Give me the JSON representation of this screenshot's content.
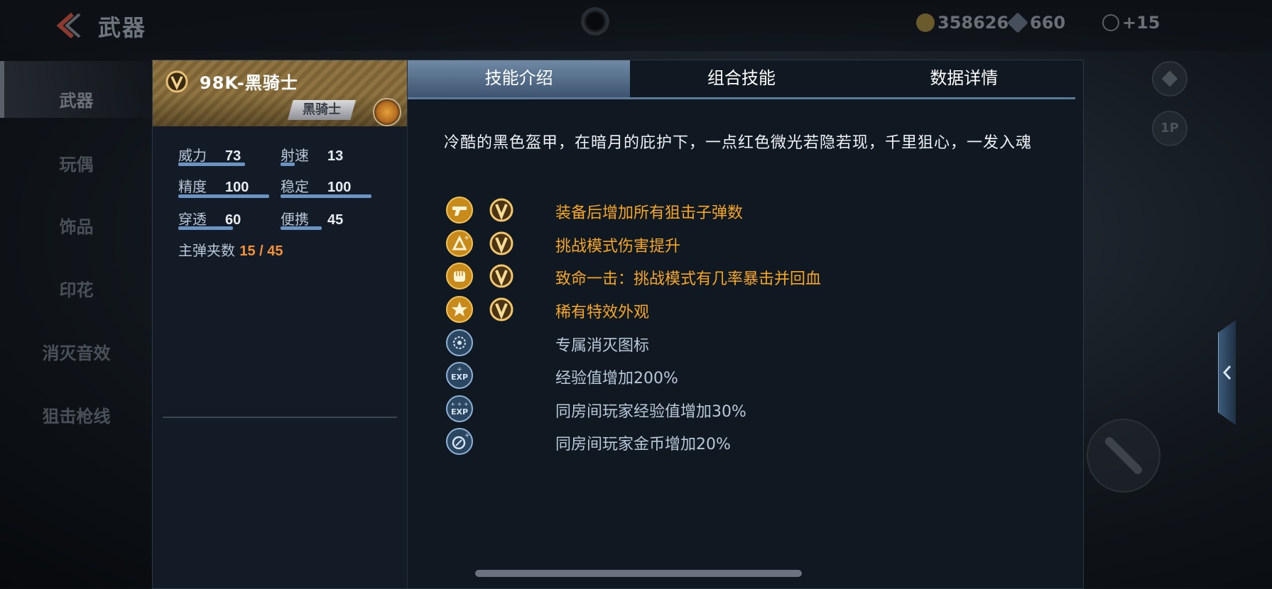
{
  "header": {
    "title": "武器",
    "gold": "358626",
    "diamond": "660",
    "energy": "+15"
  },
  "sidebar": {
    "items": [
      {
        "label": "武器"
      },
      {
        "label": "玩偶"
      },
      {
        "label": "饰品"
      },
      {
        "label": "印花"
      },
      {
        "label": "消灭音效"
      },
      {
        "label": "狙击枪线"
      }
    ]
  },
  "right_buttons": {
    "view_label": "1P"
  },
  "weapon": {
    "name": "98K-黑骑士",
    "tag": "黑骑士",
    "stats": [
      {
        "label": "威力",
        "value": "73"
      },
      {
        "label": "射速",
        "value": "13"
      },
      {
        "label": "精度",
        "value": "100"
      },
      {
        "label": "稳定",
        "value": "100"
      },
      {
        "label": "穿透",
        "value": "60"
      },
      {
        "label": "便携",
        "value": "45"
      }
    ],
    "ammo_label": "主弹夹数",
    "ammo_value": "15 / 45"
  },
  "tabs": [
    {
      "label": "技能介绍"
    },
    {
      "label": "组合技能"
    },
    {
      "label": "数据详情"
    }
  ],
  "description": "冷酷的黑色盔甲，在暗月的庇护下，一点红色微光若隐若现，千里狙心，一发入魂",
  "skills": [
    {
      "icon": "pistol-icon",
      "vip": true,
      "text": "装备后增加所有狙击子弹数"
    },
    {
      "icon": "challenge-icon",
      "vip": true,
      "text": "挑战模式伤害提升"
    },
    {
      "icon": "fist-icon",
      "vip": true,
      "text": "致命一击：挑战模式有几率暴击并回血"
    },
    {
      "icon": "star-icon",
      "vip": true,
      "text": "稀有特效外观"
    },
    {
      "icon": "kill-icon-icon",
      "vip": false,
      "text": "专属消灭图标"
    },
    {
      "icon": "exp-icon",
      "vip": false,
      "text": "经验值增加200%"
    },
    {
      "icon": "room-exp-icon",
      "vip": false,
      "text": "同房间玩家经验值增加30%"
    },
    {
      "icon": "coin-icon",
      "vip": false,
      "text": "同房间玩家金币增加20%"
    }
  ],
  "colors": {
    "gold_text": "#f5a623",
    "blue_text": "#b9c8d9",
    "ammo_accent": "#f3903a",
    "stat_bar": "#6b94c2"
  }
}
